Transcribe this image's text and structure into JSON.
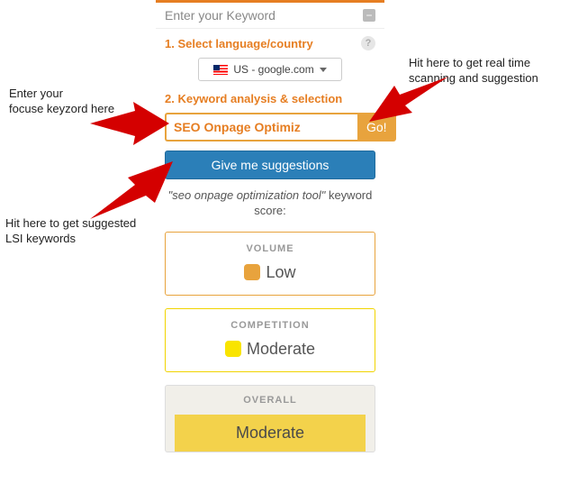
{
  "header": {
    "title": "Enter your Keyword"
  },
  "step1": {
    "title": "1. Select language/country",
    "selected": "US - google.com"
  },
  "step2": {
    "title": "2. Keyword analysis & selection"
  },
  "keyword": {
    "value": "SEO Onpage Optimiz",
    "go": "Go!"
  },
  "suggest": {
    "label": "Give me suggestions"
  },
  "score": {
    "prefix": "\"seo onpage optimization tool\"",
    "suffix": " keyword score:"
  },
  "metrics": {
    "volume": {
      "label": "VOLUME",
      "value": "Low"
    },
    "competition": {
      "label": "COMPETITION",
      "value": "Moderate"
    },
    "overall": {
      "label": "OVERALL",
      "value": "Moderate"
    }
  },
  "annotations": {
    "a1": "Enter your\nfocuse keyzord here",
    "a2": "Hit here to get real time\nscanning and suggestion",
    "a3": "Hit here to get suggested\nLSI keywords"
  }
}
